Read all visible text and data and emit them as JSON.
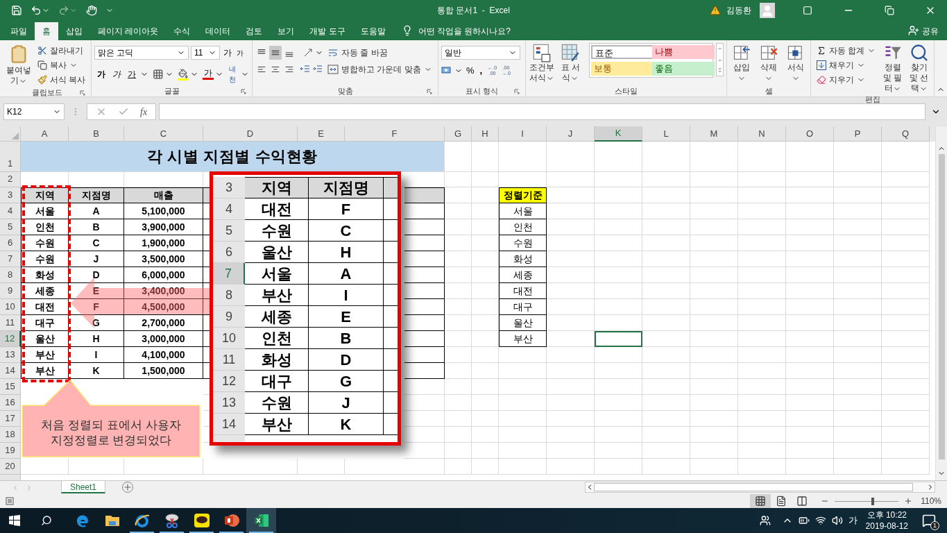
{
  "window": {
    "title": "통합 문서1  -  Excel",
    "user": "김동환"
  },
  "menu_tabs": [
    {
      "label": "파일",
      "selected": false
    },
    {
      "label": "홈",
      "selected": true
    },
    {
      "label": "삽입",
      "selected": false
    },
    {
      "label": "페이지 레이아웃",
      "selected": false
    },
    {
      "label": "수식",
      "selected": false
    },
    {
      "label": "데이터",
      "selected": false
    },
    {
      "label": "검토",
      "selected": false
    },
    {
      "label": "보기",
      "selected": false
    },
    {
      "label": "개발 도구",
      "selected": false
    },
    {
      "label": "도움말",
      "selected": false
    }
  ],
  "tell_me": "어떤 작업을 원하시나요?",
  "share": "공유",
  "ribbon": {
    "clipboard": {
      "label": "클립보드",
      "paste": "붙여넣기",
      "cut": "잘라내기",
      "copy": "복사",
      "format_painter": "서식 복사"
    },
    "font": {
      "label": "글꼴",
      "font_name": "맑은 고딕",
      "font_size": "11",
      "grow": "가",
      "shrink": "가",
      "bold": "가",
      "italic": "가",
      "underline": "가",
      "font_color": "가",
      "phonetic": "내천"
    },
    "alignment": {
      "label": "맞춤",
      "wrap_text": "자동 줄 바꿈",
      "merge_center": "병합하고 가운데 맞춤"
    },
    "number": {
      "label": "표시 형식",
      "format": "일반",
      "percent": "%",
      "comma": ",",
      "decimals": [
        {
          "top": "←.0",
          "bottom": ".00"
        },
        {
          "top": ".00",
          "bottom": "→.0"
        }
      ]
    },
    "styles": {
      "label": "스타일",
      "conditional": "조건부 서식",
      "format_table": "표 서식",
      "cell_styles": [
        {
          "label": "표준",
          "color": "#ffffff",
          "selected": true
        },
        {
          "label": "나쁨",
          "color": "#ffc7ce",
          "selected": false
        },
        {
          "label": "보통",
          "color": "#ffeb9c",
          "selected": false
        },
        {
          "label": "좋음",
          "color": "#c6efce",
          "selected": false
        }
      ]
    },
    "cells": {
      "label": "셀",
      "buttons": [
        "삽입",
        "삭제",
        "서식"
      ]
    },
    "editing": {
      "label": "편집",
      "autosum": "자동 합계",
      "fill": "채우기",
      "clear": "지우기",
      "sort_filter": "정렬 및 필터",
      "find_select": "찾기 및 선택"
    }
  },
  "formula_bar": {
    "name_box": "K12",
    "fx": "fx"
  },
  "sheet": {
    "columns": [
      {
        "label": "A",
        "selected": false
      },
      {
        "label": "B",
        "selected": false
      },
      {
        "label": "C",
        "selected": false
      },
      {
        "label": "D",
        "selected": false
      },
      {
        "label": "E",
        "selected": false
      },
      {
        "label": "F",
        "selected": false
      },
      {
        "label": "G",
        "selected": false
      },
      {
        "label": "H",
        "selected": false
      },
      {
        "label": "I",
        "selected": false
      },
      {
        "label": "J",
        "selected": false
      },
      {
        "label": "K",
        "selected": true
      },
      {
        "label": "L",
        "selected": false
      },
      {
        "label": "M",
        "selected": false
      },
      {
        "label": "N",
        "selected": false
      },
      {
        "label": "O",
        "selected": false
      },
      {
        "label": "P",
        "selected": false
      },
      {
        "label": "Q",
        "selected": false
      }
    ],
    "rows": [
      {
        "label": "1",
        "selected": false
      },
      {
        "label": "2",
        "selected": false
      },
      {
        "label": "3",
        "selected": false
      },
      {
        "label": "4",
        "selected": false
      },
      {
        "label": "5",
        "selected": false
      },
      {
        "label": "6",
        "selected": false
      },
      {
        "label": "7",
        "selected": false
      },
      {
        "label": "8",
        "selected": false
      },
      {
        "label": "9",
        "selected": false
      },
      {
        "label": "10",
        "selected": false
      },
      {
        "label": "11",
        "selected": false
      },
      {
        "label": "12",
        "selected": true
      },
      {
        "label": "13",
        "selected": false
      },
      {
        "label": "14",
        "selected": false
      },
      {
        "label": "15",
        "selected": false
      },
      {
        "label": "16",
        "selected": false
      },
      {
        "label": "17",
        "selected": false
      },
      {
        "label": "18",
        "selected": false
      },
      {
        "label": "19",
        "selected": false
      },
      {
        "label": "20",
        "selected": false
      }
    ],
    "title": "각 시별 지점별 수익현황",
    "table_headers": [
      "지역",
      "지점명",
      "매출"
    ],
    "table_rows": [
      [
        "서울",
        "A",
        "5,100,000"
      ],
      [
        "인천",
        "B",
        "3,900,000"
      ],
      [
        "수원",
        "C",
        "1,900,000"
      ],
      [
        "수원",
        "J",
        "3,500,000"
      ],
      [
        "화성",
        "D",
        "6,000,000"
      ],
      [
        "세종",
        "E",
        "3,400,000"
      ],
      [
        "대전",
        "F",
        "4,500,000"
      ],
      [
        "대구",
        "G",
        "2,700,000"
      ],
      [
        "울산",
        "H",
        "3,000,000"
      ],
      [
        "부산",
        "I",
        "4,100,000"
      ],
      [
        "부산",
        "K",
        "1,500,000"
      ]
    ],
    "criteria_header": "정렬기준",
    "criteria": [
      "서울",
      "인천",
      "수원",
      "화성",
      "세종",
      "대전",
      "대구",
      "울산",
      "부산"
    ]
  },
  "inset": {
    "header_row": "3",
    "headers": [
      "지역",
      "지점명"
    ],
    "rows": [
      {
        "number": "4",
        "region": "대전",
        "branch": "F",
        "selected": false
      },
      {
        "number": "5",
        "region": "수원",
        "branch": "C",
        "selected": false
      },
      {
        "number": "6",
        "region": "울산",
        "branch": "H",
        "selected": false
      },
      {
        "number": "7",
        "region": "서울",
        "branch": "A",
        "selected": true
      },
      {
        "number": "8",
        "region": "부산",
        "branch": "I",
        "selected": false
      },
      {
        "number": "9",
        "region": "세종",
        "branch": "E",
        "selected": false
      },
      {
        "number": "10",
        "region": "인천",
        "branch": "B",
        "selected": false
      },
      {
        "number": "11",
        "region": "화성",
        "branch": "D",
        "selected": false
      },
      {
        "number": "12",
        "region": "대구",
        "branch": "G",
        "selected": false
      },
      {
        "number": "13",
        "region": "수원",
        "branch": "J",
        "selected": false
      },
      {
        "number": "14",
        "region": "부산",
        "branch": "K",
        "selected": false
      }
    ]
  },
  "callout": "처음 정렬되 표에서 사용자\n지정정렬로 변경되었다",
  "sheet_tabs": [
    {
      "label": "Sheet1",
      "selected": true
    }
  ],
  "status": {
    "views": [
      {
        "kind": "normal",
        "selected": true
      },
      {
        "kind": "page_layout",
        "selected": false
      },
      {
        "kind": "page_break",
        "selected": false
      }
    ],
    "zoom_slider": {
      "level": 0.6
    },
    "zoom": "110%"
  },
  "taskbar": {
    "apps": [
      {
        "kind": "edge",
        "running": false,
        "selected": false
      },
      {
        "kind": "explorer",
        "running": false,
        "selected": false
      },
      {
        "kind": "ie",
        "running": true,
        "selected": false
      },
      {
        "kind": "snipping",
        "running": true,
        "selected": false
      },
      {
        "kind": "kakao",
        "running": true,
        "selected": false
      },
      {
        "kind": "powerpoint",
        "running": true,
        "selected": false
      },
      {
        "kind": "excel",
        "running": true,
        "selected": true
      }
    ],
    "ime": "가",
    "time": "오후 10:22",
    "date": "2019-08-12",
    "notifications": "1"
  }
}
